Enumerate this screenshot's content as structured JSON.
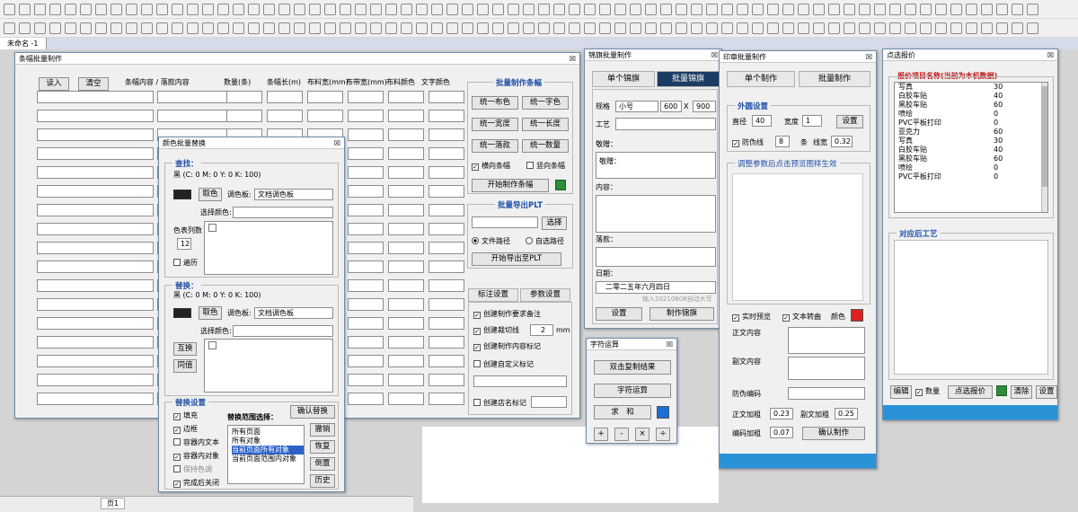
{
  "doc_tab": "未命名 -1",
  "page_tab": "页1",
  "banner": {
    "title": "条幅批量制作",
    "close": "☒",
    "read_btn": "读入",
    "clear_btn": "清空",
    "headers": [
      "条幅内容 / 落款内容",
      "数量(条)",
      "条幅长(m)",
      "布料宽(mm)",
      "布带宽(mm)",
      "布料颜色",
      "文字颜色"
    ],
    "batch_title": "批量制作条幅",
    "btns": [
      "统一布色",
      "统一字色",
      "统一宽度",
      "统一长度",
      "统一落款",
      "统一数量"
    ],
    "horizontal": "横向条幅",
    "vertical": "竖向条幅",
    "start_btn": "开始制作条幅",
    "plt_title": "批量导出PLT",
    "select_btn": "选择",
    "file_path": "文件路径",
    "auto_path": "自选路径",
    "export_btn": "开始导出至PLT",
    "tab_label": "标注设置",
    "tab_param": "参数设置",
    "opt1": "创建制作要求备注",
    "opt2": "创建裁切线",
    "opt2_val": "2",
    "opt2_unit": "mm",
    "opt3": "创建制作内容标记",
    "opt4": "创建自定义标记",
    "opt5": "创建店名标记"
  },
  "color": {
    "title": "颜色批量替换",
    "close": "☒",
    "find_title": "查找：",
    "find_color": "黑 (C: 0 M: 0 Y: 0 K: 100)",
    "pick": "取色",
    "palette_label": "调色板:",
    "palette_val": "文档调色板",
    "sel_label": "选择颜色:",
    "columns_label": "色表列数",
    "columns_val": "12",
    "traverse": "遍历",
    "replace_title": "替换：",
    "replace_color": "黑 (C: 0 M: 0 Y: 0 K: 100)",
    "swap": "互换",
    "same": "同值",
    "settings_title": "替换设置",
    "fill": "填充",
    "outline": "边框",
    "in_text": "容器内文本",
    "in_obj": "容器内对象",
    "keep": "保持色调",
    "close_done": "完成后关闭",
    "scope_label": "替换范围选择：",
    "scope": [
      "所有页面",
      "所有对象",
      "当前页面所有对象",
      "当前页面范围内对象"
    ],
    "confirm": "确认替换",
    "undo": "撤销",
    "restore": "恢复",
    "reverse": "倒置",
    "history": "历史"
  },
  "flag": {
    "title": "锦旗批量制作",
    "close": "☒",
    "tab1": "单个锦旗",
    "tab2": "批量锦旗",
    "spec_label": "规格",
    "spec_val": "小号",
    "w": "600",
    "x": "X",
    "h": "900",
    "craft": "工艺",
    "respect": "敬赠：",
    "respect_val": "敬赠：",
    "content": "内容：",
    "sign": "落款：",
    "date_label": "日期：",
    "date_val": "二零二五年六月四日",
    "set_btn": "设置",
    "make_btn": "制作锦旗",
    "wm": "输入20210808自动大写"
  },
  "seal": {
    "title": "印章批量制作",
    "close": "☒",
    "tab1": "单个制作",
    "tab2": "批量制作",
    "outer": "外圆设置",
    "dia_label": "直径",
    "dia_val": "40",
    "width_label": "宽度",
    "width_val": "1",
    "set_btn": "设置",
    "anti": "防伪线",
    "anti_val": "8",
    "tiao": "条",
    "line_w": "线宽",
    "line_val": "0.32",
    "hint": "调整参数后点击预览图样生效",
    "preview": "实时预览",
    "text_curve": "文本转曲",
    "color_label": "颜色",
    "main_text": "正文内容",
    "sub_text": "副文内容",
    "code": "防伪编码",
    "main_bold": "正文加粗",
    "main_bold_val": "0.23",
    "sub_bold": "副文加粗",
    "sub_bold_val": "0.25",
    "code_bold": "编码加粗",
    "code_bold_val": "0.07",
    "confirm": "确认制作",
    "accent": "#e02020"
  },
  "calc": {
    "title": "字符运算",
    "close": "☒",
    "copy_btn": "双击复制结果",
    "calc_btn": "字符运算",
    "sum_btn": "求　和",
    "ops": [
      "+",
      "-",
      "×",
      "÷"
    ]
  },
  "quote": {
    "title": "点选报价",
    "close": "☒",
    "list_title": "报价项目名称(当前为本机数据)",
    "items": [
      [
        "写真",
        "30"
      ],
      [
        "白胶车贴",
        "40"
      ],
      [
        "黑胶车贴",
        "60"
      ],
      [
        "喷绘",
        "0"
      ],
      [
        "PVC平板打印",
        "0"
      ],
      [
        "亚克力",
        "60"
      ],
      [
        "写真",
        "30"
      ],
      [
        "白胶车贴",
        "40"
      ],
      [
        "黑胶车贴",
        "60"
      ],
      [
        "喷绘",
        "0"
      ],
      [
        "PVC平板打印",
        "0"
      ]
    ],
    "after": "对应后工艺",
    "edit": "编辑",
    "qty": "数量",
    "pick_btn": "点选报价",
    "clear": "清除",
    "setting": "设置"
  }
}
